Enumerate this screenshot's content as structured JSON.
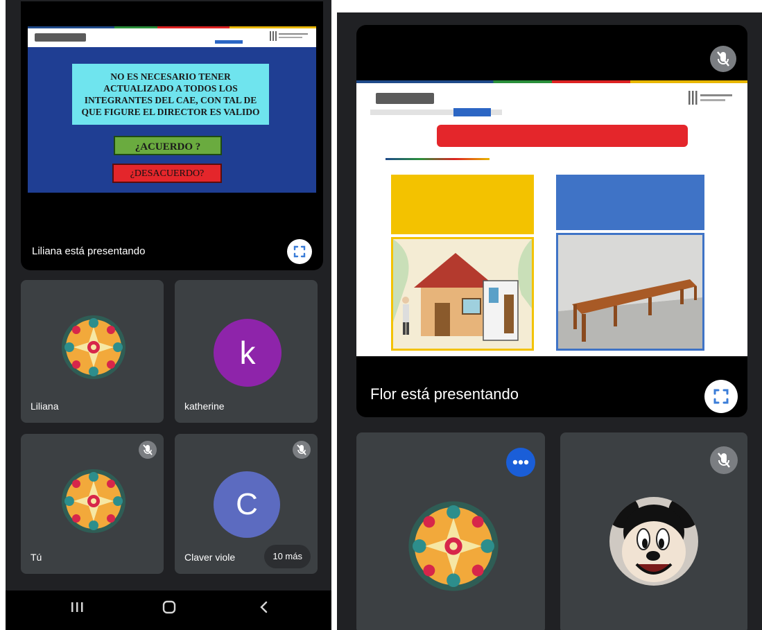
{
  "left": {
    "slide": {
      "question": "NO ES NECESARIO TENER ACTUALIZADO A TODOS LOS INTEGRANTES DEL CAE, CON TAL DE QUE FIGURE EL DIRECTOR ES VALIDO",
      "agree_label": "¿ACUERDO ?",
      "disagree_label": "¿DESACUERDO?"
    },
    "presenting_text": "Liliana está presentando",
    "tiles": [
      {
        "name": "Liliana"
      },
      {
        "name": "katherine",
        "initial": "k",
        "color": "#8e24aa"
      },
      {
        "name": "Tú"
      },
      {
        "name": "Claver viole",
        "initial": "C",
        "color": "#5c6bc0"
      }
    ],
    "more_label": "10 más"
  },
  "right": {
    "presenting_text": "Flor está presentando"
  },
  "colors": {
    "meet_bg": "#202124",
    "tile_bg": "#3c4043",
    "slide_blue": "#1f3e93"
  },
  "icons": {
    "fullscreen": "fullscreen-icon",
    "mic_off": "mic-off-icon",
    "more": "more-options-icon",
    "nav_recents": "recents-icon",
    "nav_home": "home-icon",
    "nav_back": "back-icon"
  }
}
